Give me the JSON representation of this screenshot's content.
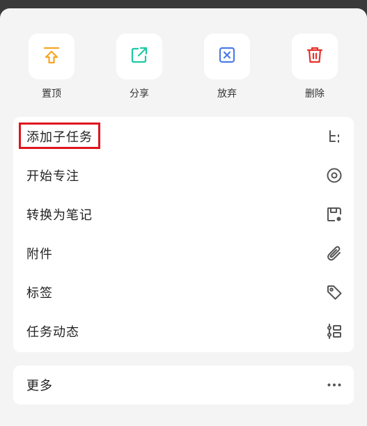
{
  "quick_actions": [
    {
      "label": "置顶",
      "icon": "pin-top-icon",
      "color": "#F5A623"
    },
    {
      "label": "分享",
      "icon": "share-icon",
      "color": "#1DC9A4"
    },
    {
      "label": "放弃",
      "icon": "abandon-x-icon",
      "color": "#4A7BE8"
    },
    {
      "label": "删除",
      "icon": "trash-icon",
      "color": "#E5312B"
    }
  ],
  "menu": {
    "items": [
      {
        "label": "添加子任务",
        "icon": "subtask-icon"
      },
      {
        "label": "开始专注",
        "icon": "focus-target-icon"
      },
      {
        "label": "转换为笔记",
        "icon": "convert-note-icon"
      },
      {
        "label": "附件",
        "icon": "paperclip-icon"
      },
      {
        "label": "标签",
        "icon": "tag-icon"
      },
      {
        "label": "任务动态",
        "icon": "activity-icon"
      }
    ],
    "highlighted_item": "添加子任务",
    "highlight_color": "#E0141E"
  },
  "more": {
    "label": "更多",
    "icon": "more-dots-icon"
  },
  "colors": {
    "sheet_background": "#F4F4F4",
    "card_background": "#FFFFFF",
    "icon_gray": "#555555"
  }
}
